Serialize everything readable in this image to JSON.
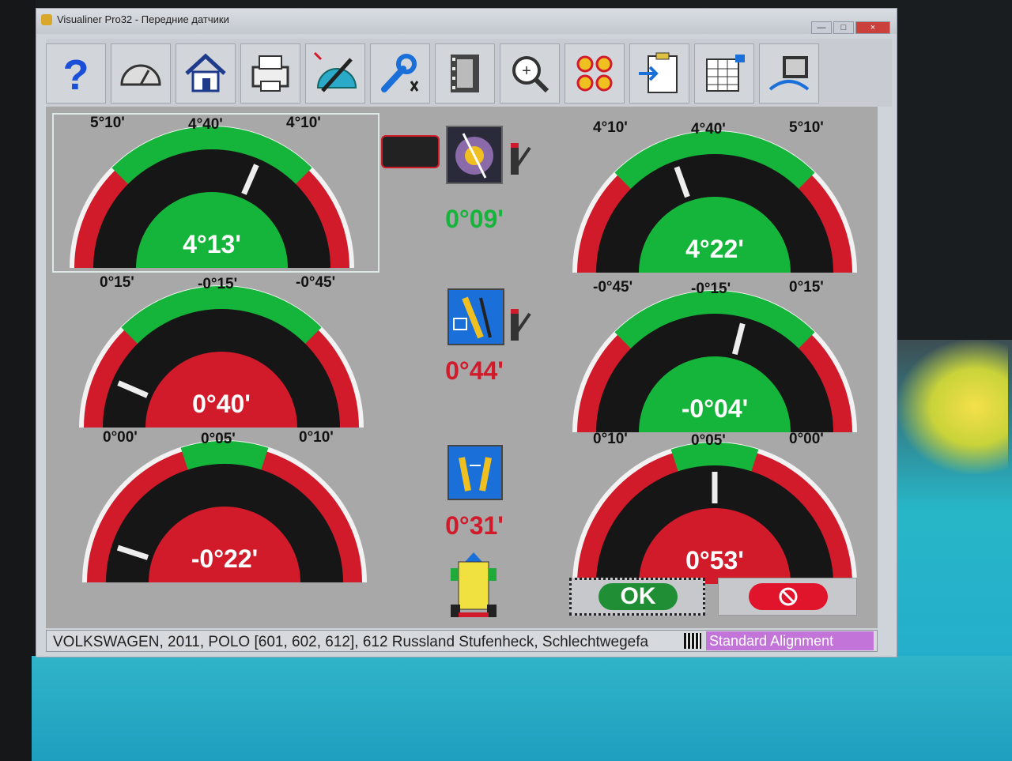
{
  "window": {
    "app_name": "Visualiner Pro32",
    "separator": "-",
    "screen_name": "Передние датчики",
    "min_label": "—",
    "max_label": "□",
    "close_label": "×"
  },
  "toolbar": {
    "buttons": [
      {
        "name": "help-button",
        "icon": "question-icon"
      },
      {
        "name": "dashboard-button",
        "icon": "gauge-icon"
      },
      {
        "name": "home-button",
        "icon": "home-icon"
      },
      {
        "name": "print-button",
        "icon": "printer-icon"
      },
      {
        "name": "protractor-button",
        "icon": "protractor-icon"
      },
      {
        "name": "adjust-button",
        "icon": "wrench-icon"
      },
      {
        "name": "video-button",
        "icon": "film-icon"
      },
      {
        "name": "zoom-button",
        "icon": "magnifier-icon"
      },
      {
        "name": "sensors-button",
        "icon": "wheels-icon"
      },
      {
        "name": "import-button",
        "icon": "clipboard-import-icon"
      },
      {
        "name": "spreadsheet-button",
        "icon": "spreadsheet-icon"
      },
      {
        "name": "hardware-button",
        "icon": "hardware-icon"
      }
    ]
  },
  "gauges": [
    {
      "id": "caster-left",
      "left_label": "5°10'",
      "mid_label": "4°40'",
      "right_label": "4°10'",
      "value": "4°13'",
      "status": "ok",
      "needle_pos": 0.63,
      "green_start": 0.25,
      "green_end": 0.75,
      "colors": {
        "ok": "#15b43a",
        "bad": "#d11b2b"
      }
    },
    {
      "id": "caster-right",
      "left_label": "4°10'",
      "mid_label": "4°40'",
      "right_label": "5°10'",
      "value": "4°22'",
      "status": "ok",
      "needle_pos": 0.39,
      "green_start": 0.25,
      "green_end": 0.75
    },
    {
      "id": "camber-left",
      "left_label": "0°15'",
      "mid_label": "-0°15'",
      "right_label": "-0°45'",
      "value": "0°40'",
      "status": "bad",
      "needle_pos": 0.13,
      "green_start": 0.25,
      "green_end": 0.75
    },
    {
      "id": "camber-right",
      "left_label": "-0°45'",
      "mid_label": "-0°15'",
      "right_label": "0°15'",
      "value": "-0°04'",
      "status": "ok",
      "needle_pos": 0.58,
      "green_start": 0.25,
      "green_end": 0.75
    },
    {
      "id": "toe-left",
      "left_label": "0°00'",
      "mid_label": "0°05'",
      "right_label": "0°10'",
      "value": "-0°22'",
      "status": "bad",
      "needle_pos": 0.1,
      "green_start": 0.4,
      "green_end": 0.6
    },
    {
      "id": "toe-right",
      "left_label": "0°10'",
      "mid_label": "0°05'",
      "right_label": "0°00'",
      "value": "0°53'",
      "status": "bad",
      "needle_pos": 0.5,
      "green_start": 0.4,
      "green_end": 0.6
    }
  ],
  "middle": {
    "caster_diff": {
      "value": "0°09'",
      "status": "ok"
    },
    "camber_diff": {
      "value": "0°44'",
      "status": "bad"
    },
    "toe_total": {
      "value": "0°31'",
      "status": "bad"
    }
  },
  "buttons": {
    "ok_label": "OK",
    "cancel_icon": "no-entry-icon"
  },
  "statusbar": {
    "vehicle": "VOLKSWAGEN, 2011, POLO [601, 602, 612], 612 Russland Stufenheck, Schlechtwegefa",
    "mode": "Standard Alignment"
  },
  "colors": {
    "ok": "#15b43a",
    "bad": "#d11b2b",
    "gauge_body": "#161616",
    "mode_badge": "#c274d9"
  }
}
